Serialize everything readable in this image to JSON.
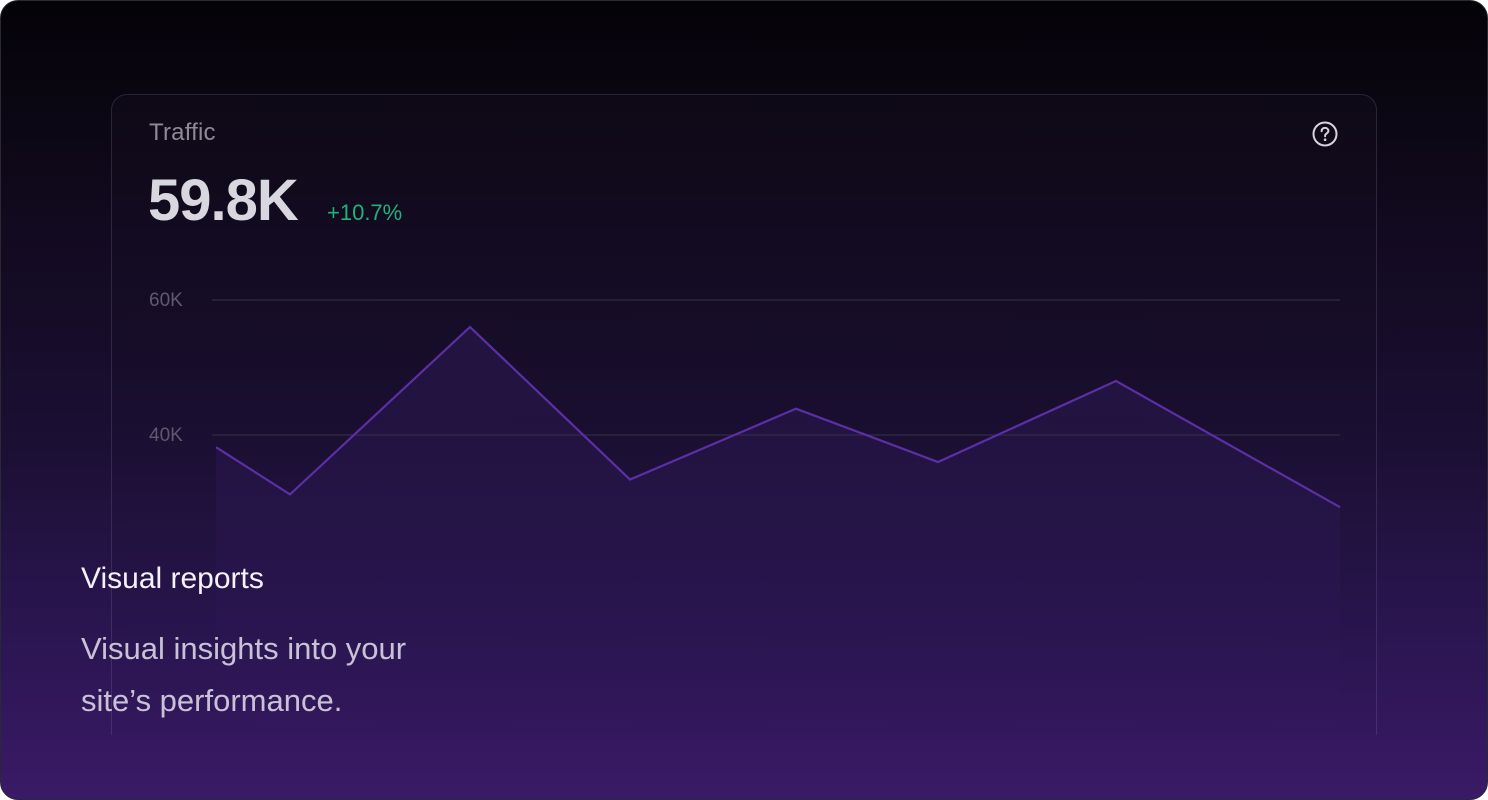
{
  "card": {
    "title": "Traffic",
    "value": "59.8K",
    "delta": "+10.7%",
    "help_icon": "question-circle-icon"
  },
  "feature": {
    "title": "Visual reports",
    "description": "Visual insights into your site’s performance."
  },
  "colors": {
    "accent_line": "#5b2fa6",
    "delta_positive": "#22b07a",
    "grid": "#2e2740"
  },
  "chart_data": {
    "type": "area",
    "title": "",
    "xlabel": "",
    "ylabel": "",
    "ylim": [
      20000,
      60000
    ],
    "y_ticks": [
      "60K",
      "40K"
    ],
    "y_tick_values": [
      60000,
      40000
    ],
    "grid": true,
    "series": [
      {
        "values": [
          38200,
          31200,
          56000,
          33400,
          43900,
          36000,
          48000,
          29300
        ]
      }
    ],
    "x": [
      0,
      1,
      2,
      3,
      4,
      5,
      6,
      7
    ]
  }
}
